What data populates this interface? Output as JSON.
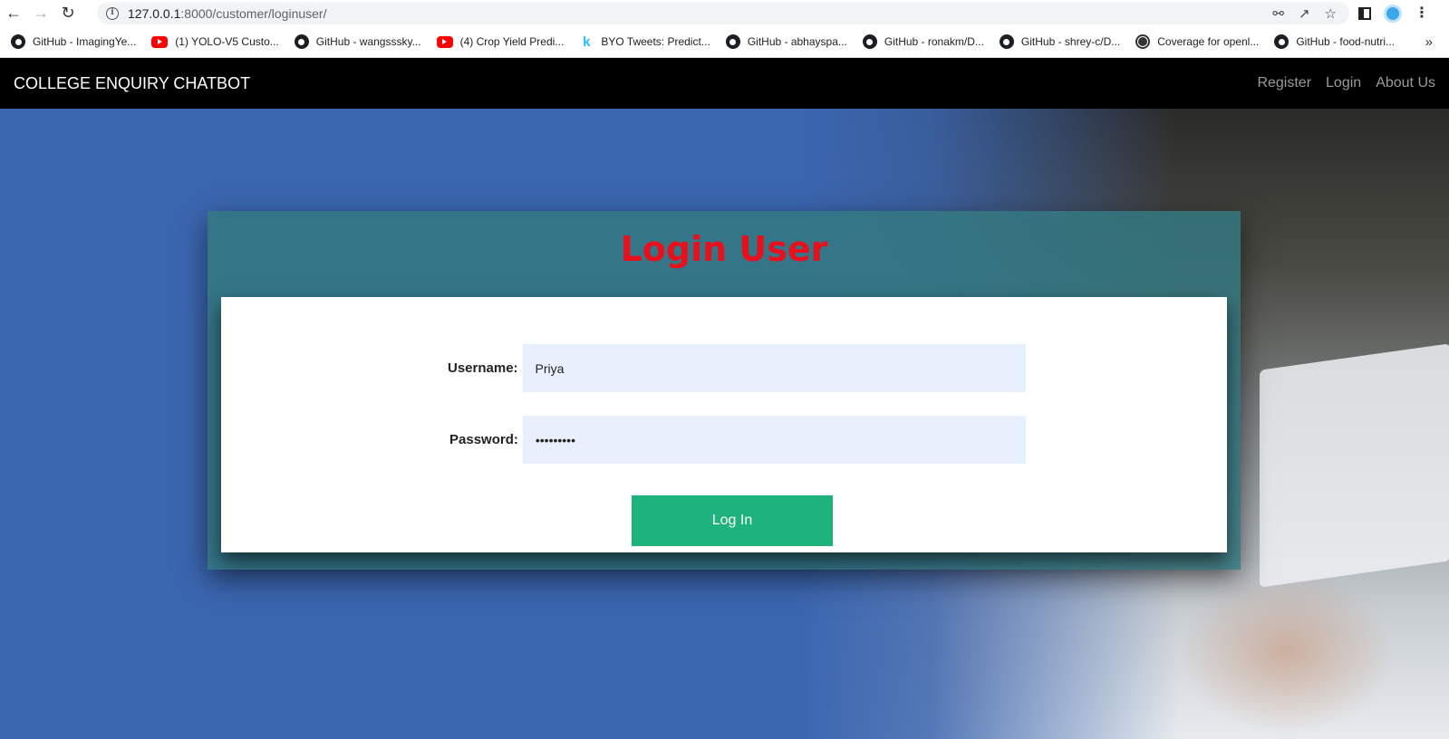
{
  "browser": {
    "url_host": "127.0.0.1",
    "url_path": ":8000/customer/loginuser/",
    "bookmarks": [
      {
        "label": "GitHub - ImagingYe...",
        "icon": "github-icon"
      },
      {
        "label": "(1) YOLO-V5 Custo...",
        "icon": "youtube-icon"
      },
      {
        "label": "GitHub - wangsssky...",
        "icon": "github-icon"
      },
      {
        "label": "(4) Crop Yield Predi...",
        "icon": "youtube-icon"
      },
      {
        "label": "BYO Tweets: Predict...",
        "icon": "kaggle-icon"
      },
      {
        "label": "GitHub - abhayspa...",
        "icon": "github-icon"
      },
      {
        "label": "GitHub - ronakm/D...",
        "icon": "github-icon"
      },
      {
        "label": "GitHub - shrey-c/D...",
        "icon": "github-icon"
      },
      {
        "label": "Coverage for openl...",
        "icon": "globe-icon"
      },
      {
        "label": "GitHub - food-nutri...",
        "icon": "github-icon"
      }
    ]
  },
  "navbar": {
    "brand": "COLLEGE ENQUIRY CHATBOT",
    "links": [
      "Register",
      "Login",
      "About Us"
    ]
  },
  "login": {
    "title": "Login User",
    "username_label": "Username:",
    "username_value": "Priya",
    "password_label": "Password:",
    "password_value": "•••••••••",
    "submit_label": "Log In"
  },
  "colors": {
    "page_bg": "#3b66b0",
    "title_red": "#e8101c",
    "button_green": "#1eb37c",
    "field_bg": "#e8f0fe"
  }
}
